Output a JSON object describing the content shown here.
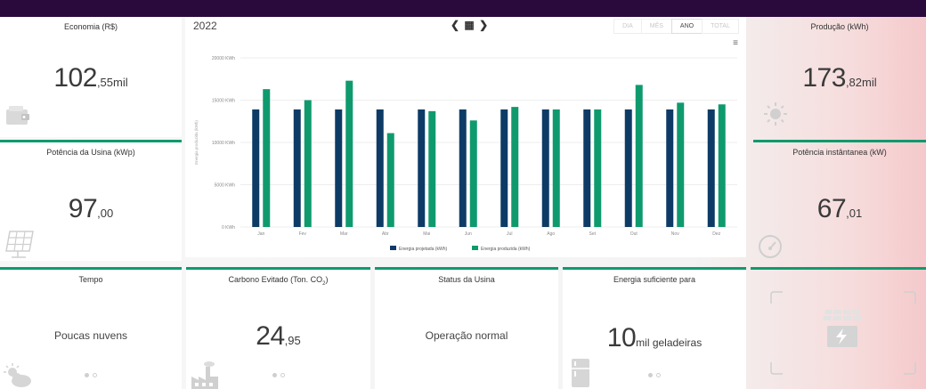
{
  "economia": {
    "title": "Economia (R$)",
    "int": "102",
    "dec": ",55mil",
    "icon": "wallet-icon"
  },
  "potencia_usina": {
    "title": "Potência da Usina (kWp)",
    "int": "97",
    "dec": ",00",
    "icon": "solar-panel-icon"
  },
  "producao": {
    "title": "Produção (kWh)",
    "int": "173",
    "dec": ",82mil",
    "icon": "sun-icon"
  },
  "potencia_inst": {
    "title": "Potência instântanea (kW)",
    "int": "67",
    "dec": ",01",
    "icon": "gauge-icon"
  },
  "tempo": {
    "title": "Tempo",
    "value": "Poucas nuvens",
    "icon": "partly-cloudy-icon"
  },
  "carbono": {
    "title": "Carbono Evitado (Ton. CO",
    "title_sub": "2",
    "title_end": ")",
    "int": "24",
    "dec": ",95",
    "icon": "factory-icon"
  },
  "status": {
    "title": "Status da Usina",
    "value": "Operação normal"
  },
  "energia": {
    "title": "Energia suficiente para",
    "int": "10",
    "dec": "mil geladeiras",
    "icon": "fridge-icon"
  },
  "chart_header": {
    "year": "2022",
    "prev": "❮",
    "calendar": "▦",
    "next": "❯",
    "tabs": [
      "DIA",
      "MÊS",
      "ANO",
      "TOTAL"
    ],
    "active_tab": "ANO",
    "menu": "≡"
  },
  "chart_data": {
    "type": "bar",
    "categories": [
      "Jan",
      "Fev",
      "Mar",
      "Abr",
      "Mai",
      "Jun",
      "Jul",
      "Ago",
      "Set",
      "Out",
      "Nov",
      "Dez"
    ],
    "series": [
      {
        "name": "Energia projetada (kWh)",
        "color": "#0d3b66",
        "values": [
          13900,
          13900,
          13900,
          13900,
          13900,
          13900,
          13900,
          13900,
          13900,
          13900,
          13900,
          13900
        ]
      },
      {
        "name": "Energia produzida (kWh)",
        "color": "#0f9a6e",
        "values": [
          16300,
          15000,
          17300,
          11100,
          13700,
          12600,
          14200,
          13900,
          13900,
          16800,
          14700,
          14500
        ]
      }
    ],
    "ylabel": "Energia produzida (kWh)",
    "ylim": [
      0,
      20000
    ],
    "yticks": [
      0,
      5000,
      10000,
      15000,
      20000
    ],
    "ytick_labels": [
      "0 KWh",
      "5000 KWh",
      "10000 KWh",
      "15000 KWh",
      "20000 KWh"
    ],
    "legend": "bottom-center",
    "grid": true
  }
}
